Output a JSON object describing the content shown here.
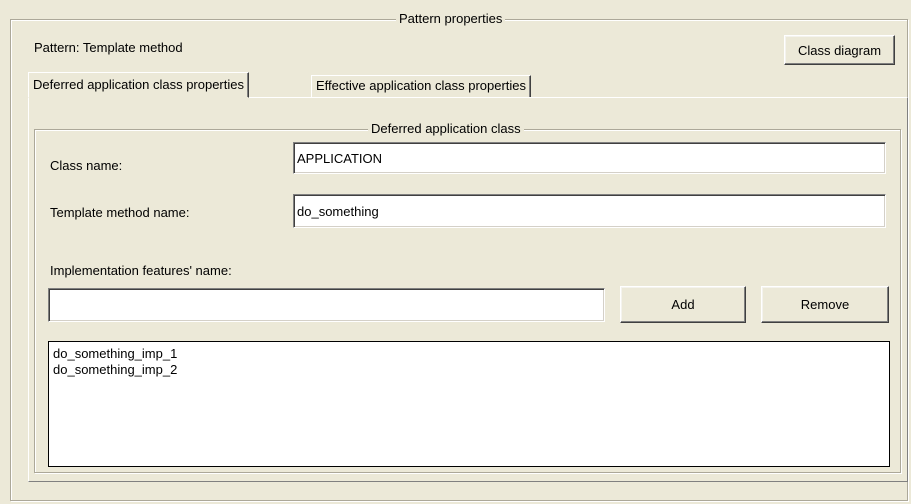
{
  "pattern_group": {
    "title": "Pattern properties",
    "pattern_label": "Pattern: Template method",
    "class_diagram_button": "Class diagram"
  },
  "tabs": [
    {
      "label": "Deferred application class properties",
      "active": true
    },
    {
      "label": "Effective application class properties",
      "active": false
    }
  ],
  "deferred_group": {
    "title": "Deferred application class",
    "class_name_label": "Class name:",
    "class_name_value": "APPLICATION",
    "template_method_label": "Template method name:",
    "template_method_value": "do_something",
    "impl_features_label": "Implementation features' name:",
    "impl_feature_input_value": "",
    "add_button": "Add",
    "remove_button": "Remove",
    "impl_features": [
      "do_something_imp_1",
      "do_something_imp_2"
    ]
  }
}
